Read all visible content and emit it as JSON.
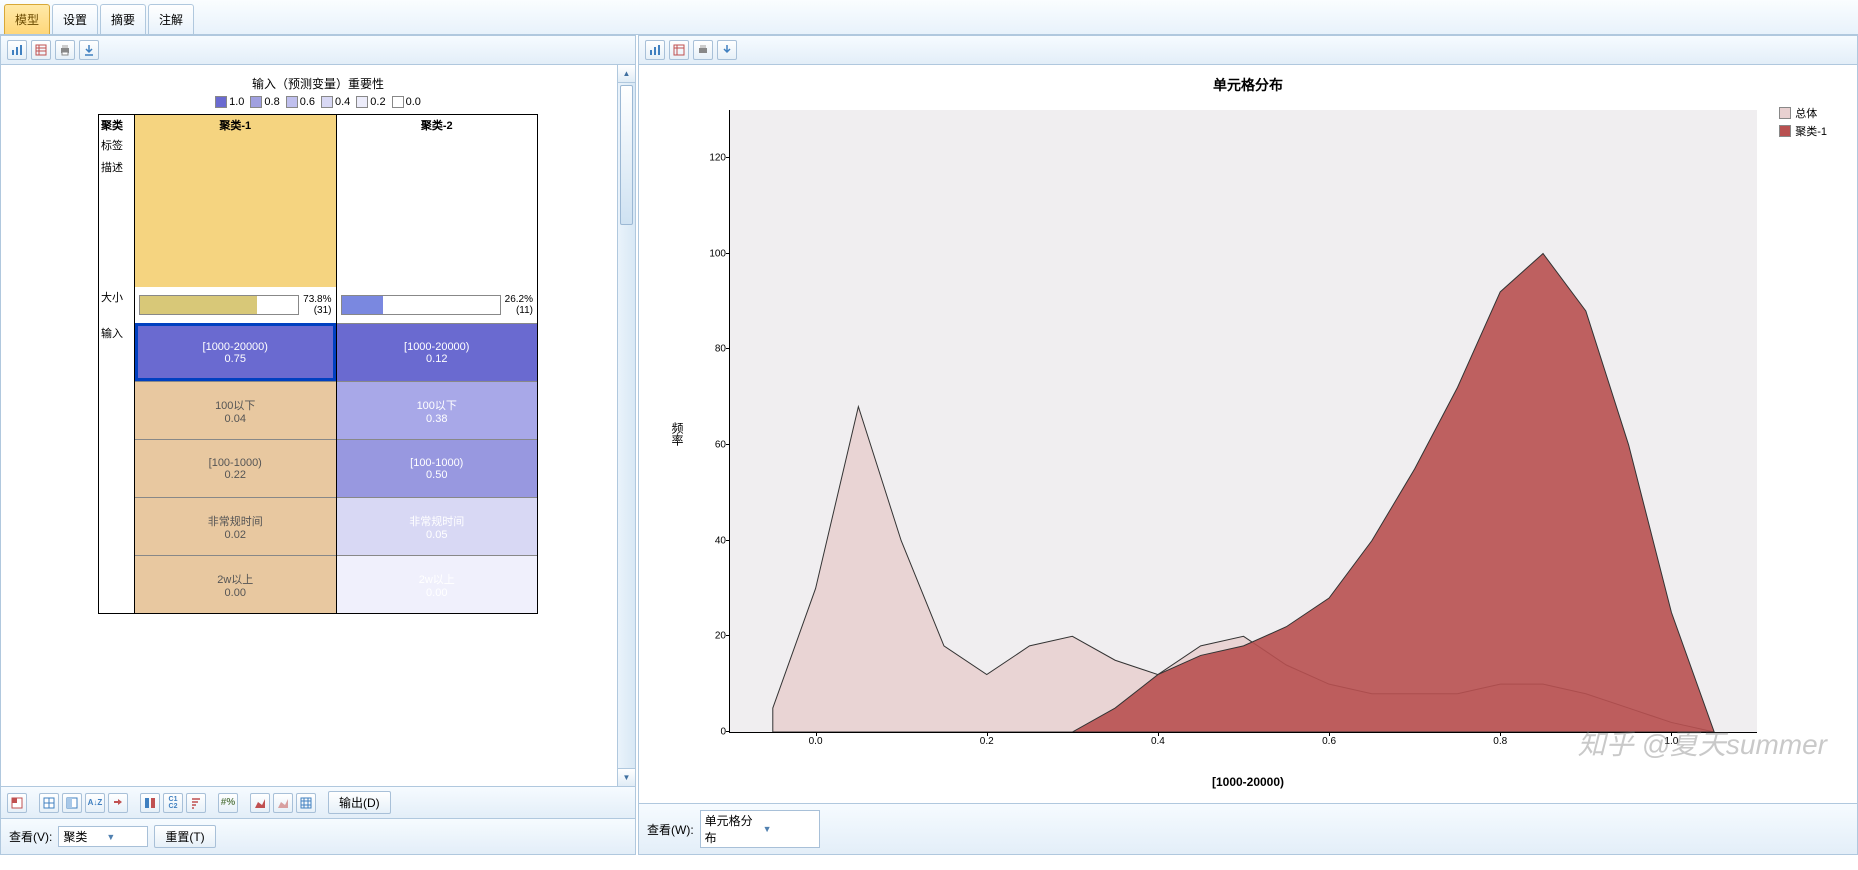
{
  "tabs": [
    "模型",
    "设置",
    "摘要",
    "注解"
  ],
  "activeTab": 0,
  "cluster": {
    "title": "输入（预测变量）重要性",
    "legend": [
      {
        "v": "1.0",
        "c": "#6a6ad0"
      },
      {
        "v": "0.8",
        "c": "#a0a0e0"
      },
      {
        "v": "0.6",
        "c": "#c0c0ee"
      },
      {
        "v": "0.4",
        "c": "#d8d8f4"
      },
      {
        "v": "0.2",
        "c": "#ececfa"
      },
      {
        "v": "0.0",
        "c": "#ffffff"
      }
    ],
    "rowHeaders": [
      "聚类",
      "标签",
      "描述",
      "大小",
      "输入"
    ],
    "cols": [
      "聚类-1",
      "聚类-2"
    ],
    "size": [
      {
        "pct": "73.8%",
        "n": "(31)"
      },
      {
        "pct": "26.2%",
        "n": "(11)"
      }
    ],
    "inputs": [
      {
        "c1": {
          "label": "[1000-20000)",
          "val": "0.75",
          "bg": "#6a6ad0",
          "sel": true
        },
        "c2": {
          "label": "[1000-20000)",
          "val": "0.12",
          "bg": "#6a6ad0"
        }
      },
      {
        "c1": {
          "label": "100以下",
          "val": "0.04"
        },
        "c2": {
          "label": "100以下",
          "val": "0.38",
          "bg": "#a8a8e8"
        }
      },
      {
        "c1": {
          "label": "[100-1000)",
          "val": "0.22"
        },
        "c2": {
          "label": "[100-1000)",
          "val": "0.50",
          "bg": "#9898e0"
        }
      },
      {
        "c1": {
          "label": "非常规时间",
          "val": "0.02"
        },
        "c2": {
          "label": "非常规时间",
          "val": "0.05",
          "bg": "#d8d8f4"
        }
      },
      {
        "c1": {
          "label": "2w以上",
          "val": "0.00"
        },
        "c2": {
          "label": "2w以上",
          "val": "0.00",
          "bg": "#f0f0fc"
        }
      }
    ]
  },
  "leftFoot": {
    "output": "输出(D)"
  },
  "leftBottom": {
    "viewLabel": "查看(V):",
    "viewValue": "聚类",
    "resetLabel": "重置(T)"
  },
  "rightBottom": {
    "viewLabel": "查看(W):",
    "viewValue": "单元格分布"
  },
  "chart_data": {
    "type": "area",
    "title": "单元格分布",
    "xlabel": "[1000-20000)",
    "ylabel": "频率",
    "xlim": [
      -0.1,
      1.1
    ],
    "ylim": [
      0,
      130
    ],
    "xticks": [
      0.0,
      0.2,
      0.4,
      0.6,
      0.8,
      1.0
    ],
    "yticks": [
      0,
      20,
      40,
      60,
      80,
      100,
      120
    ],
    "series": [
      {
        "name": "总体",
        "color": "#e8d0d0",
        "x": [
          -0.05,
          0.0,
          0.05,
          0.1,
          0.15,
          0.2,
          0.25,
          0.3,
          0.35,
          0.4,
          0.45,
          0.5,
          0.55,
          0.6,
          0.65,
          0.7,
          0.75,
          0.8,
          0.85,
          0.9,
          0.95,
          1.0,
          1.05
        ],
        "y": [
          5,
          30,
          68,
          40,
          18,
          12,
          18,
          20,
          15,
          12,
          18,
          20,
          14,
          10,
          8,
          8,
          8,
          10,
          10,
          8,
          5,
          2,
          0
        ]
      },
      {
        "name": "聚类-1",
        "color": "#b85050",
        "x": [
          0.3,
          0.35,
          0.4,
          0.45,
          0.5,
          0.55,
          0.6,
          0.65,
          0.7,
          0.75,
          0.8,
          0.85,
          0.9,
          0.95,
          1.0,
          1.05
        ],
        "y": [
          0,
          5,
          12,
          16,
          18,
          22,
          28,
          40,
          55,
          72,
          92,
          100,
          88,
          60,
          25,
          0
        ]
      }
    ]
  },
  "watermark": "知乎 @夏天summer"
}
